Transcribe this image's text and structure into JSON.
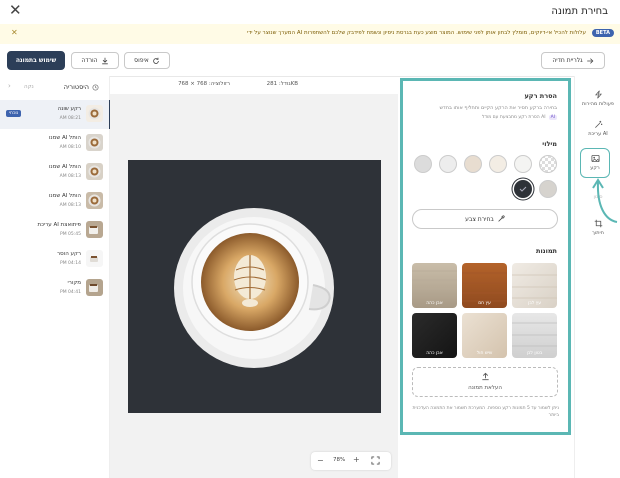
{
  "window": {
    "title": "בחירת תמונה"
  },
  "banner": {
    "badge": "BETA",
    "text": "המערך שנוצר על ידי AI עלולות להכיל אי-דיוקים, מומלץ לבחון אותן לפני שימוש. המוצר מוצע כעת בגרסת ניסיון ונשמח לפידבק שלכם להשתפרות"
  },
  "toolbar": {
    "back_label": "גלריית חדיה",
    "reset_label": "איפוס",
    "download_label": "הורדה",
    "use_label": "שימוש בתמונה"
  },
  "info": {
    "size_label": "גודל:",
    "size_value": "281KB",
    "resolution_label": "רזולוציה:",
    "resolution_value": "768 × 768"
  },
  "history": {
    "title": "היסטוריה",
    "clear_label": "נקה",
    "items": [
      {
        "name": "רקע שונה",
        "time": "AM 08:21",
        "badge": "נוכחי"
      },
      {
        "name": "שמנו AI הותל",
        "time": "AM 08:10"
      },
      {
        "name": "שמנו AI הותל",
        "time": "AM 08:13"
      },
      {
        "name": "שמנו AI הותל",
        "time": "AM 08:13"
      },
      {
        "name": "עריכת AI פיתואצת",
        "time": "PM 05:45"
      },
      {
        "name": "רקע הוסר",
        "time": "PM 04:14"
      },
      {
        "name": "מקורי",
        "time": "PM 04:41"
      }
    ]
  },
  "zoom": {
    "percent": "78"
  },
  "rail": {
    "items": [
      {
        "label": "פעולות מהירות",
        "icon": "bolt-icon"
      },
      {
        "label": "עריכת AI",
        "icon": "magic-wand-icon"
      },
      {
        "label": "רקע",
        "icon": "image-icon"
      },
      {
        "label": "סינון",
        "icon": "filter-icon"
      },
      {
        "label": "חיתוך",
        "icon": "crop-icon"
      }
    ]
  },
  "panel": {
    "remove_title": "הסרת רקע",
    "remove_desc": "בחירה ברקע תסיר את הרקע הקיים ותחליף אותו בחדש",
    "remove_note": "הסרת רקע מתבצעת עם מודל AI",
    "ai_badge": "AI",
    "fills_title": "מילוי",
    "pick_color_label": "בחירת צבע",
    "images_title": "תמונות",
    "upload_label": "העלאת תמונה",
    "footer_note": "ניתן לשמור עד 5 תמונות רקע נוספות. המערכת תשמור את התמונה העדכנית ביותר",
    "fills": [
      {
        "color": "checker"
      },
      {
        "color": "#f4f4f2"
      },
      {
        "color": "#f3ede4"
      },
      {
        "color": "#e8ddd0"
      },
      {
        "color": "#ededed"
      },
      {
        "color": "#dcdcdc"
      },
      {
        "color": "#d6d3ce"
      },
      {
        "color": "#2e3238",
        "selected": true
      }
    ],
    "images": [
      {
        "label": "עץ לבן"
      },
      {
        "label": "עץ חם"
      },
      {
        "label": "אבן כהה"
      },
      {
        "label": "בטון לבן"
      },
      {
        "label": "שיש חול"
      },
      {
        "label": "אבן כהה"
      }
    ]
  },
  "colors": {
    "accent": "#5bb7b4",
    "primary": "#2c3e58",
    "banner_bg": "#fffbe6"
  }
}
